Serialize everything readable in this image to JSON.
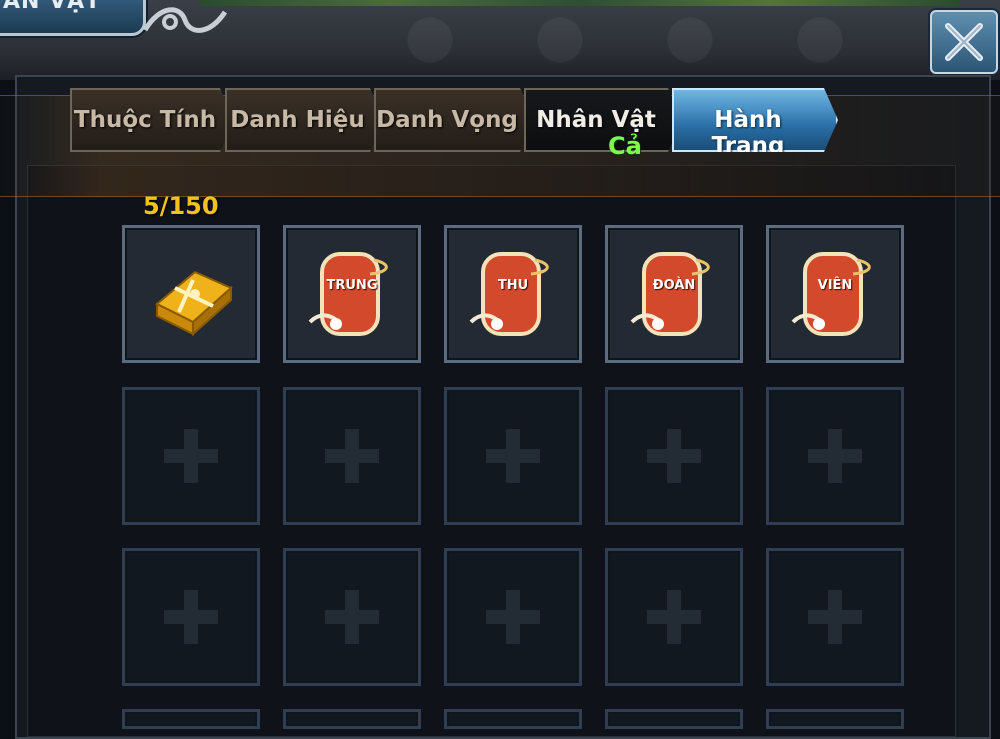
{
  "header": {
    "title": "ÂN VẬT",
    "close_icon": "close-x-icon"
  },
  "tabs": [
    {
      "label": "Thuộc Tính",
      "state": "inactive"
    },
    {
      "label": "Danh Hiệu",
      "state": "inactive"
    },
    {
      "label": "Danh Vọng",
      "state": "inactive"
    },
    {
      "label": "Nhân Vật",
      "state": "dark"
    },
    {
      "label": "Hành Trang",
      "state": "active"
    }
  ],
  "tab_sublabel": "Cả",
  "inventory": {
    "count_text": "5/150",
    "items": [
      {
        "name": "gift-box",
        "icon": "gift-box-icon",
        "text": ""
      },
      {
        "name": "card-trung",
        "icon": "red-card-icon",
        "text": "TRUNG"
      },
      {
        "name": "card-thu",
        "icon": "red-card-icon",
        "text": "THU"
      },
      {
        "name": "card-doan",
        "icon": "red-card-icon",
        "text": "ĐOÀN"
      },
      {
        "name": "card-vien",
        "icon": "red-card-icon",
        "text": "VIÊN"
      }
    ],
    "empty_slot_icon": "plus-icon"
  },
  "colors": {
    "accent_gold": "#f3c020",
    "sublabel_green": "#7dff4a",
    "active_tab_blue": "#2a6fa6",
    "card_red": "#d2492b"
  }
}
